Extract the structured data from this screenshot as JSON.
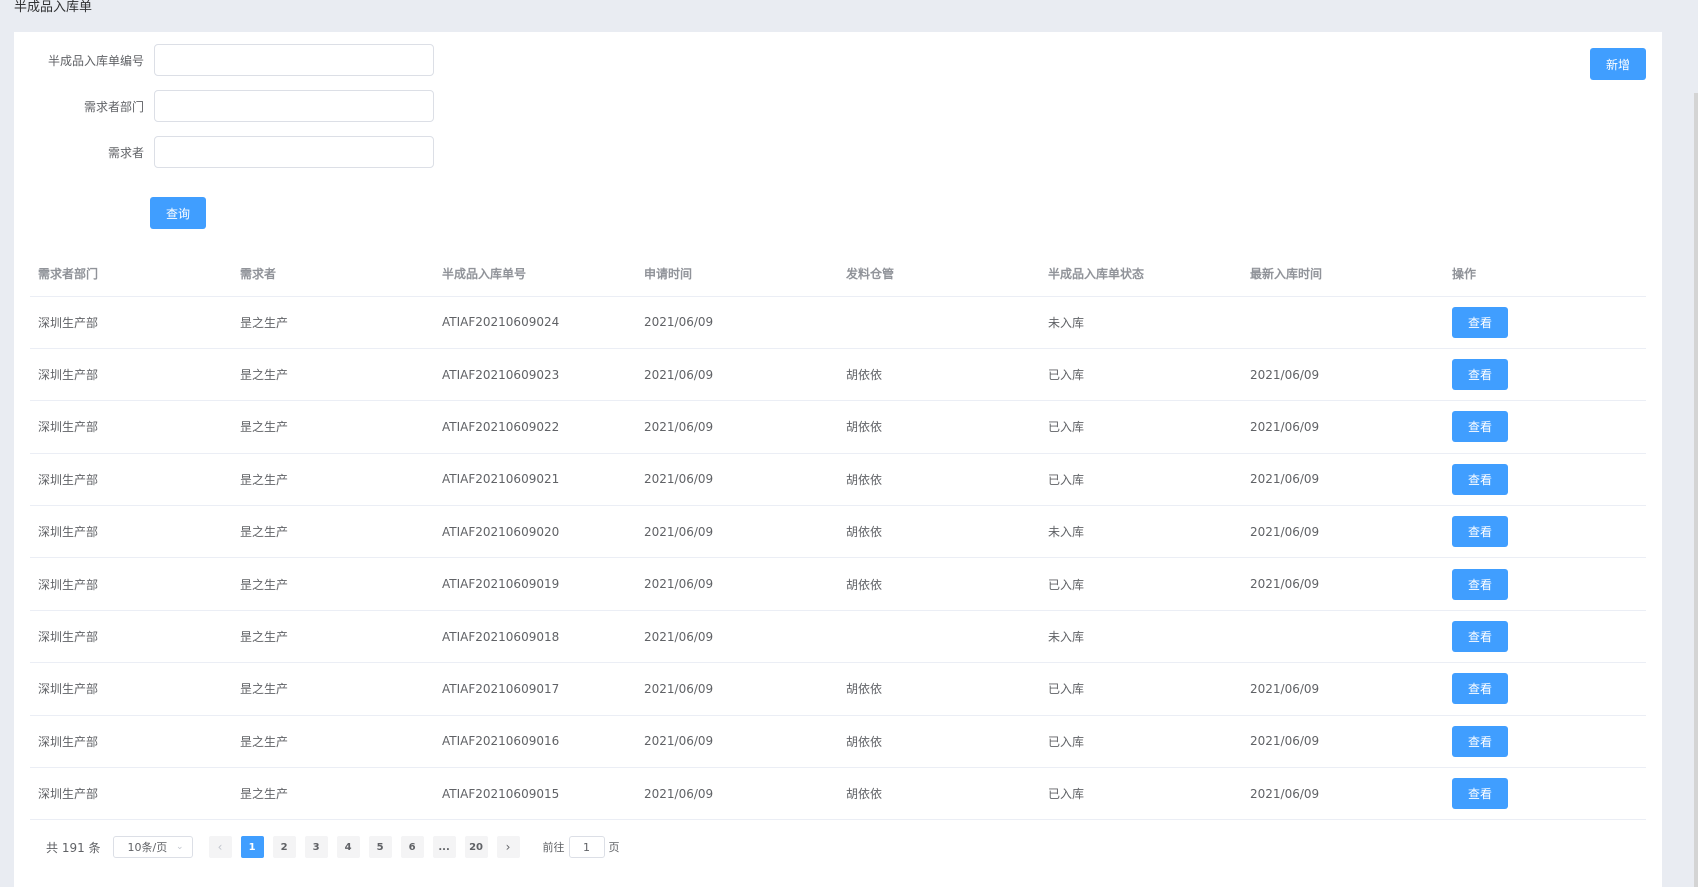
{
  "page": {
    "title": "半成品入库单",
    "add_label": "新增"
  },
  "search": {
    "fields": [
      {
        "label": "半成品入库单编号",
        "value": "",
        "placeholder": ""
      },
      {
        "label": "需求者部门",
        "value": "",
        "placeholder": ""
      },
      {
        "label": "需求者",
        "value": "",
        "placeholder": ""
      }
    ],
    "query_label": "查询"
  },
  "table": {
    "headers": [
      "需求者部门",
      "需求者",
      "半成品入库单号",
      "申请时间",
      "发料仓管",
      "半成品入库单状态",
      "最新入库时间",
      "操作"
    ],
    "action_label": "查看",
    "rows": [
      [
        "深圳生产部",
        "昰之生产",
        "ATIAF20210609024",
        "2021/06/09",
        "",
        "未入库",
        ""
      ],
      [
        "深圳生产部",
        "昰之生产",
        "ATIAF20210609023",
        "2021/06/09",
        "胡依依",
        "已入库",
        "2021/06/09"
      ],
      [
        "深圳生产部",
        "昰之生产",
        "ATIAF20210609022",
        "2021/06/09",
        "胡依依",
        "已入库",
        "2021/06/09"
      ],
      [
        "深圳生产部",
        "昰之生产",
        "ATIAF20210609021",
        "2021/06/09",
        "胡依依",
        "已入库",
        "2021/06/09"
      ],
      [
        "深圳生产部",
        "昰之生产",
        "ATIAF20210609020",
        "2021/06/09",
        "胡依依",
        "未入库",
        "2021/06/09"
      ],
      [
        "深圳生产部",
        "昰之生产",
        "ATIAF20210609019",
        "2021/06/09",
        "胡依依",
        "已入库",
        "2021/06/09"
      ],
      [
        "深圳生产部",
        "昰之生产",
        "ATIAF20210609018",
        "2021/06/09",
        "",
        "未入库",
        ""
      ],
      [
        "深圳生产部",
        "昰之生产",
        "ATIAF20210609017",
        "2021/06/09",
        "胡依依",
        "已入库",
        "2021/06/09"
      ],
      [
        "深圳生产部",
        "昰之生产",
        "ATIAF20210609016",
        "2021/06/09",
        "胡依依",
        "已入库",
        "2021/06/09"
      ],
      [
        "深圳生产部",
        "昰之生产",
        "ATIAF20210609015",
        "2021/06/09",
        "胡依依",
        "已入库",
        "2021/06/09"
      ]
    ]
  },
  "pagination": {
    "total_label": "共 191 条",
    "page_size_label": "10条/页",
    "prev_icon": "chevron-left-icon",
    "next_icon": "chevron-right-icon",
    "prev_glyph": "‹",
    "next_glyph": "›",
    "pages": [
      "1",
      "2",
      "3",
      "4",
      "5",
      "6",
      "...",
      "20"
    ],
    "current_page": "1",
    "jump_prefix": "前往",
    "jump_value": "1",
    "jump_suffix": "页"
  },
  "colors": {
    "primary": "#409eff",
    "background": "#e9ecf2",
    "border": "#ebeef5"
  }
}
